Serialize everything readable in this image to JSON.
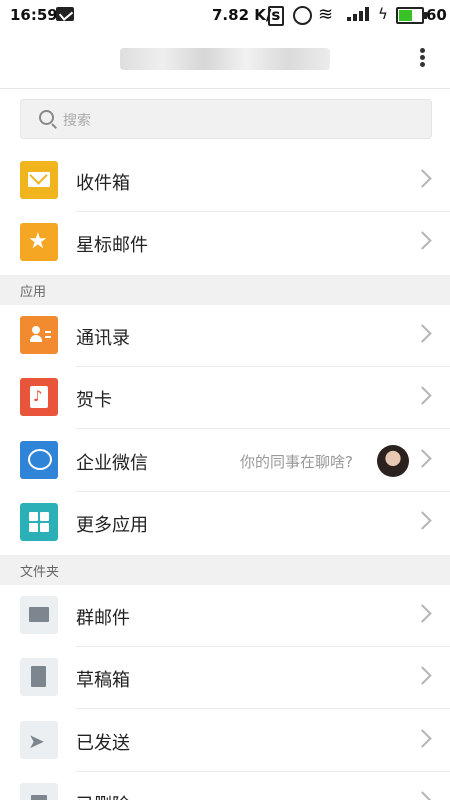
{
  "status_bar": {
    "time": "16:59",
    "net_speed": "7.82 K/s",
    "battery": "60",
    "battery_fill": 0.6,
    "accent_battery": "#39c226"
  },
  "title_bar": {
    "account_blurred": "",
    "more_icon": "more-vertical-icon"
  },
  "search": {
    "placeholder": "搜索"
  },
  "mail_items": [
    {
      "label": "收件箱",
      "icon": "inbox-icon",
      "color": "#f0b41c"
    },
    {
      "label": "星标邮件",
      "icon": "star-icon",
      "color": "#f5a623"
    }
  ],
  "sections": {
    "apps": "应用",
    "folders": "文件夹"
  },
  "app_items": [
    {
      "label": "通讯录",
      "icon": "contacts-icon",
      "color": "#f28b30"
    },
    {
      "label": "贺卡",
      "icon": "greeting-card-icon",
      "color": "#e8553a"
    },
    {
      "label": "企业微信",
      "icon": "wework-icon",
      "color": "#2f84d8",
      "hint": "你的同事在聊啥?"
    },
    {
      "label": "更多应用",
      "icon": "more-apps-icon",
      "color": "#2bb0b8"
    }
  ],
  "folder_items": [
    {
      "label": "群邮件",
      "icon": "folder-icon"
    },
    {
      "label": "草稿箱",
      "icon": "drafts-icon"
    },
    {
      "label": "已发送",
      "icon": "sent-icon"
    },
    {
      "label": "已删除",
      "icon": "trash-icon"
    }
  ],
  "icon_bg_neutral": "#eceff1"
}
